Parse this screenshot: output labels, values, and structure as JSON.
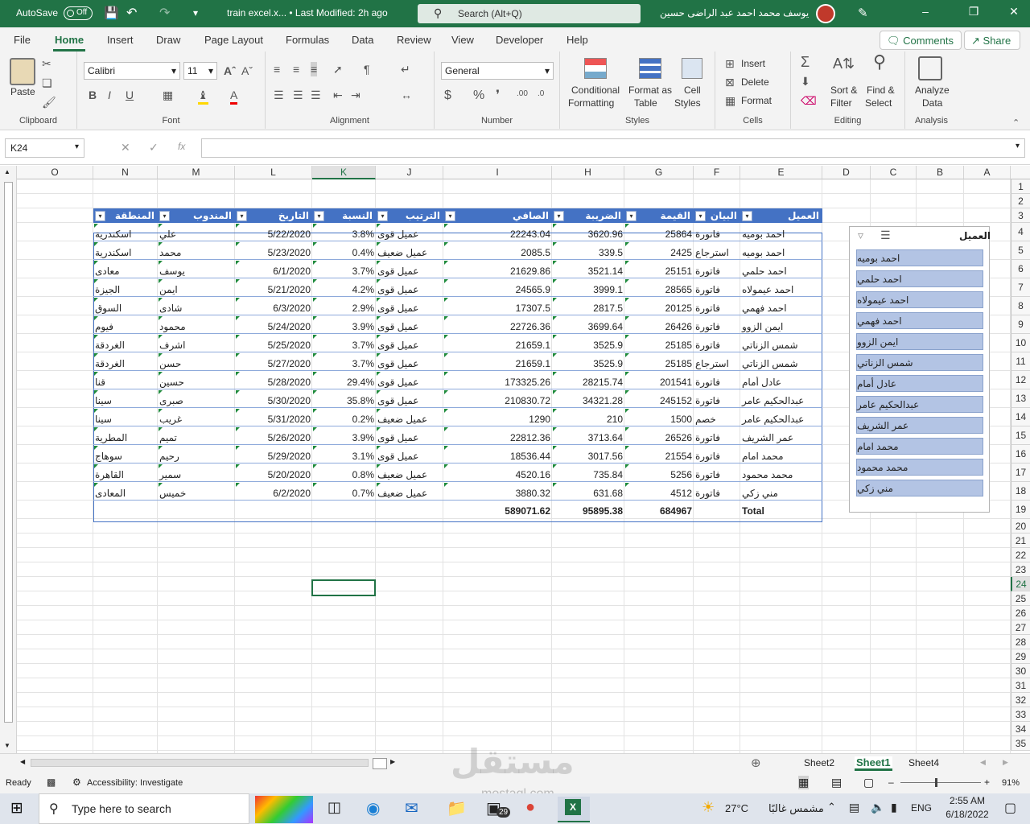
{
  "titlebar": {
    "autosave": "AutoSave",
    "toggle": "Off",
    "doc_title": "train excel.x... • Last Modified: 2h ago",
    "search_placeholder": "Search (Alt+Q)",
    "user_name": "يوسف محمد احمد عبد الراضى حسين"
  },
  "menu": {
    "tabs": [
      "File",
      "Home",
      "Insert",
      "Draw",
      "Page Layout",
      "Formulas",
      "Data",
      "Review",
      "View",
      "Developer",
      "Help"
    ],
    "active": "Home",
    "comments": "Comments",
    "share": "Share"
  },
  "ribbon": {
    "clipboard": {
      "paste": "Paste",
      "label": "Clipboard"
    },
    "font": {
      "name": "Calibri",
      "size": "11",
      "label": "Font"
    },
    "alignment": {
      "label": "Alignment"
    },
    "number": {
      "format": "General",
      "label": "Number"
    },
    "styles": {
      "conditional": "Conditional",
      "formatting": "Formatting",
      "format_as": "Format as",
      "table": "Table",
      "cell": "Cell",
      "cell_styles": "Styles",
      "label": "Styles"
    },
    "cells": {
      "insert": "Insert",
      "delete": "Delete",
      "format": "Format",
      "label": "Cells"
    },
    "editing": {
      "sort": "Sort &",
      "filter": "Filter",
      "find": "Find &",
      "select": "Select",
      "label": "Editing"
    },
    "analysis": {
      "analyze": "Analyze",
      "data": "Data",
      "label": "Analysis"
    }
  },
  "formula_bar": {
    "name_box": "K24",
    "fx": "fx",
    "formula": ""
  },
  "columns": [
    "O",
    "N",
    "M",
    "L",
    "K",
    "J",
    "I",
    "H",
    "G",
    "F",
    "E",
    "D",
    "C",
    "B",
    "A"
  ],
  "rows": [
    "1",
    "2",
    "3",
    "4",
    "5",
    "6",
    "7",
    "8",
    "9",
    "10",
    "11",
    "12",
    "13",
    "14",
    "15",
    "16",
    "17",
    "18",
    "19",
    "20",
    "21",
    "22",
    "23",
    "24",
    "25",
    "26",
    "27",
    "28",
    "29",
    "30",
    "31",
    "32",
    "33",
    "34",
    "35"
  ],
  "table": {
    "headers": {
      "E": "العميل",
      "F": "البيان",
      "G": "القيمة",
      "H": "الضريبة",
      "I": "الصافي",
      "J": "الترتيب",
      "K": "النسبة",
      "L": "التاريخ",
      "M": "المندوب",
      "N": "المنطقة"
    },
    "rows": [
      {
        "E": "احمد بوميه",
        "F": "فاتورة",
        "G": "25864",
        "H": "3620.96",
        "I": "22243.04",
        "J": "عميل قوى",
        "K": "3.8%",
        "L": "5/22/2020",
        "M": "علي",
        "N": "اسكندرية"
      },
      {
        "E": "احمد بوميه",
        "F": "استرجاع",
        "G": "2425",
        "H": "339.5",
        "I": "2085.5",
        "J": "عميل ضعيف",
        "K": "0.4%",
        "L": "5/23/2020",
        "M": "محمد",
        "N": "اسكندرية"
      },
      {
        "E": "احمد حلمي",
        "F": "فاتورة",
        "G": "25151",
        "H": "3521.14",
        "I": "21629.86",
        "J": "عميل قوى",
        "K": "3.7%",
        "L": "6/1/2020",
        "M": "يوسف",
        "N": "معادى"
      },
      {
        "E": "احمد عيمولاه",
        "F": "فاتورة",
        "G": "28565",
        "H": "3999.1",
        "I": "24565.9",
        "J": "عميل قوى",
        "K": "4.2%",
        "L": "5/21/2020",
        "M": "ايمن",
        "N": "الجيزة"
      },
      {
        "E": "احمد فهمي",
        "F": "فاتورة",
        "G": "20125",
        "H": "2817.5",
        "I": "17307.5",
        "J": "عميل قوى",
        "K": "2.9%",
        "L": "6/3/2020",
        "M": "شادى",
        "N": "السوق"
      },
      {
        "E": "ايمن الزوو",
        "F": "فاتورة",
        "G": "26426",
        "H": "3699.64",
        "I": "22726.36",
        "J": "عميل قوى",
        "K": "3.9%",
        "L": "5/24/2020",
        "M": "محمود",
        "N": "فيوم"
      },
      {
        "E": "شمس الزناتي",
        "F": "فاتورة",
        "G": "25185",
        "H": "3525.9",
        "I": "21659.1",
        "J": "عميل قوى",
        "K": "3.7%",
        "L": "5/25/2020",
        "M": "اشرف",
        "N": "الغردقة"
      },
      {
        "E": "شمس الزناتي",
        "F": "استرجاع",
        "G": "25185",
        "H": "3525.9",
        "I": "21659.1",
        "J": "عميل قوى",
        "K": "3.7%",
        "L": "5/27/2020",
        "M": "حسن",
        "N": "الغردقة"
      },
      {
        "E": "عادل أمام",
        "F": "فاتورة",
        "G": "201541",
        "H": "28215.74",
        "I": "173325.26",
        "J": "عميل قوى",
        "K": "29.4%",
        "L": "5/28/2020",
        "M": "حسين",
        "N": "قنا"
      },
      {
        "E": "عبدالحكيم عامر",
        "F": "فاتورة",
        "G": "245152",
        "H": "34321.28",
        "I": "210830.72",
        "J": "عميل قوى",
        "K": "35.8%",
        "L": "5/30/2020",
        "M": "صبرى",
        "N": "سينا"
      },
      {
        "E": "عبدالحكيم عامر",
        "F": "خصم",
        "G": "1500",
        "H": "210",
        "I": "1290",
        "J": "عميل ضعيف",
        "K": "0.2%",
        "L": "5/31/2020",
        "M": "غريب",
        "N": "سينا"
      },
      {
        "E": "عمر الشريف",
        "F": "فاتورة",
        "G": "26526",
        "H": "3713.64",
        "I": "22812.36",
        "J": "عميل قوى",
        "K": "3.9%",
        "L": "5/26/2020",
        "M": "تميم",
        "N": "المطرية"
      },
      {
        "E": "محمد امام",
        "F": "فاتورة",
        "G": "21554",
        "H": "3017.56",
        "I": "18536.44",
        "J": "عميل قوى",
        "K": "3.1%",
        "L": "5/29/2020",
        "M": "رحيم",
        "N": "سوهاج"
      },
      {
        "E": "محمد محمود",
        "F": "فاتورة",
        "G": "5256",
        "H": "735.84",
        "I": "4520.16",
        "J": "عميل ضعيف",
        "K": "0.8%",
        "L": "5/20/2020",
        "M": "سمير",
        "N": "القاهرة"
      },
      {
        "E": "مني زكي",
        "F": "فاتورة",
        "G": "4512",
        "H": "631.68",
        "I": "3880.32",
        "J": "عميل ضعيف",
        "K": "0.7%",
        "L": "6/2/2020",
        "M": "خميس",
        "N": "المعادى"
      }
    ],
    "total": {
      "E": "Total",
      "G": "684967",
      "H": "95895.38",
      "I": "589071.62"
    }
  },
  "slicer": {
    "title": "العميل",
    "items": [
      "احمد بوميه",
      "احمد حلمي",
      "احمد عيمولاه",
      "احمد فهمي",
      "ايمن الزوو",
      "شمس الزناتي",
      "عادل أمام",
      "عبدالحكيم عامر",
      "عمر الشريف",
      "محمد امام",
      "محمد محمود",
      "مني زكي"
    ]
  },
  "sheet_tabs": {
    "tabs": [
      "Sheet2",
      "Sheet1",
      "Sheet4"
    ],
    "active": "Sheet1"
  },
  "status": {
    "ready": "Ready",
    "accessibility": "Accessibility: Investigate",
    "zoom": "91%"
  },
  "taskbar": {
    "search": "Type here to search",
    "weather": "27°C",
    "weather_text": "مشمس غالبًا",
    "lang": "ENG",
    "time": "2:55 AM",
    "date": "6/18/2022",
    "badge": "29"
  },
  "watermark": {
    "main": "مستقل",
    "sub": "mostaql.com"
  },
  "colors": {
    "excel_green": "#217346",
    "table_header": "#4472c4",
    "slicer_item": "#b3c4e4"
  }
}
